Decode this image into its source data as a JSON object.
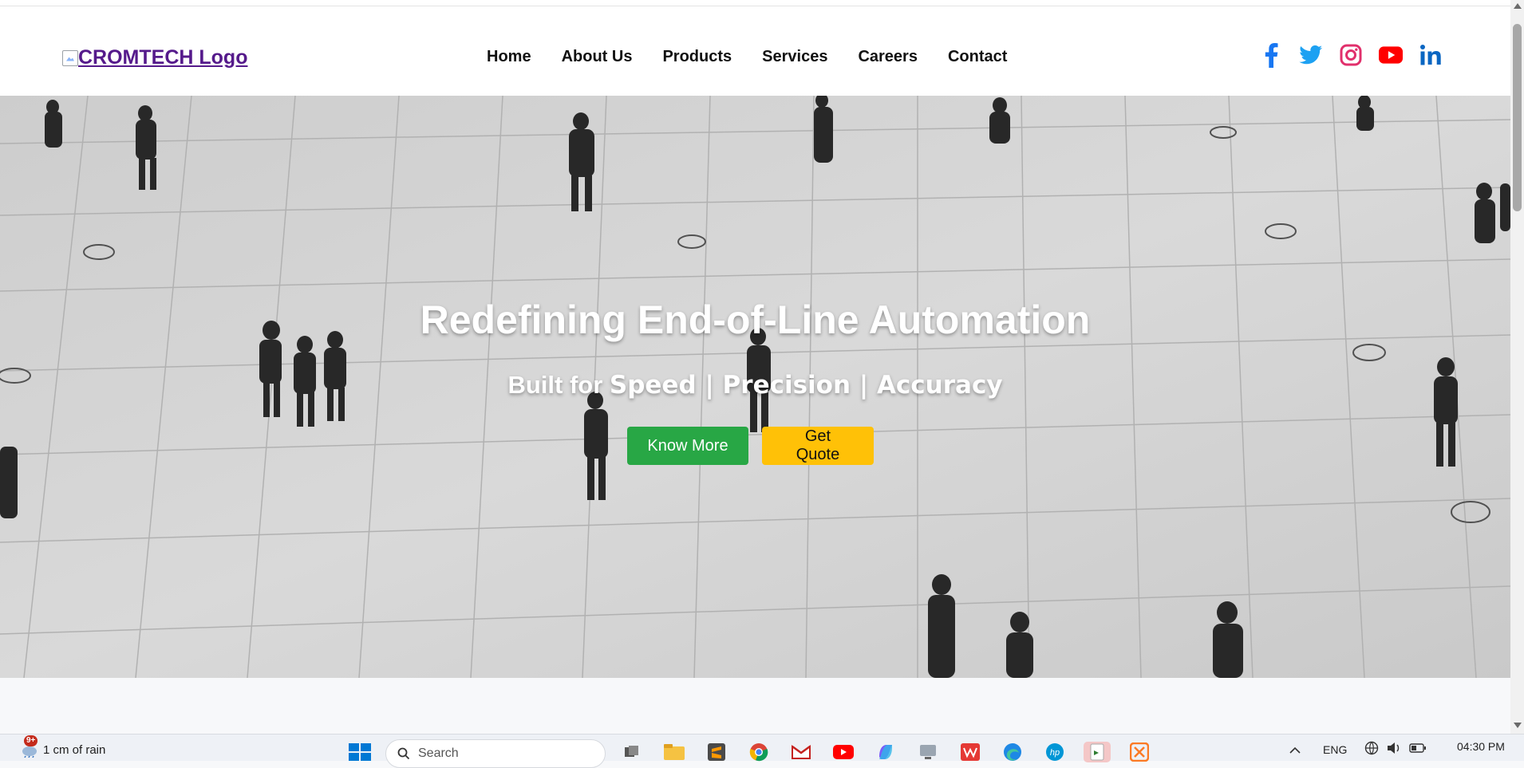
{
  "brand": {
    "logo_alt": "CROMTECH Logo"
  },
  "nav": {
    "items": [
      {
        "label": "Home"
      },
      {
        "label": "About Us"
      },
      {
        "label": "Products"
      },
      {
        "label": "Services"
      },
      {
        "label": "Careers"
      },
      {
        "label": "Contact"
      }
    ]
  },
  "socials": {
    "items": [
      {
        "icon": "facebook-icon",
        "color": "#1877f2"
      },
      {
        "icon": "twitter-icon",
        "color": "#1da1f2"
      },
      {
        "icon": "instagram-icon",
        "color": "#e1306c"
      },
      {
        "icon": "youtube-icon",
        "color": "#ff0000"
      },
      {
        "icon": "linkedin-icon",
        "color": "#0a66c2"
      }
    ]
  },
  "hero": {
    "title": "Redefining End-of-Line Automation",
    "subtitle_prefix": "Built for",
    "subtitle_strong": "Speed | Precision | Accuracy",
    "primary_button": "Know More",
    "secondary_button": "Get Quote",
    "primary_color": "#28a745",
    "secondary_color": "#ffc107"
  },
  "taskbar": {
    "weather": "1 cm of rain",
    "weather_badge": "9+",
    "search_placeholder": "Search",
    "language": "ENG",
    "time": "04:30 PM"
  }
}
